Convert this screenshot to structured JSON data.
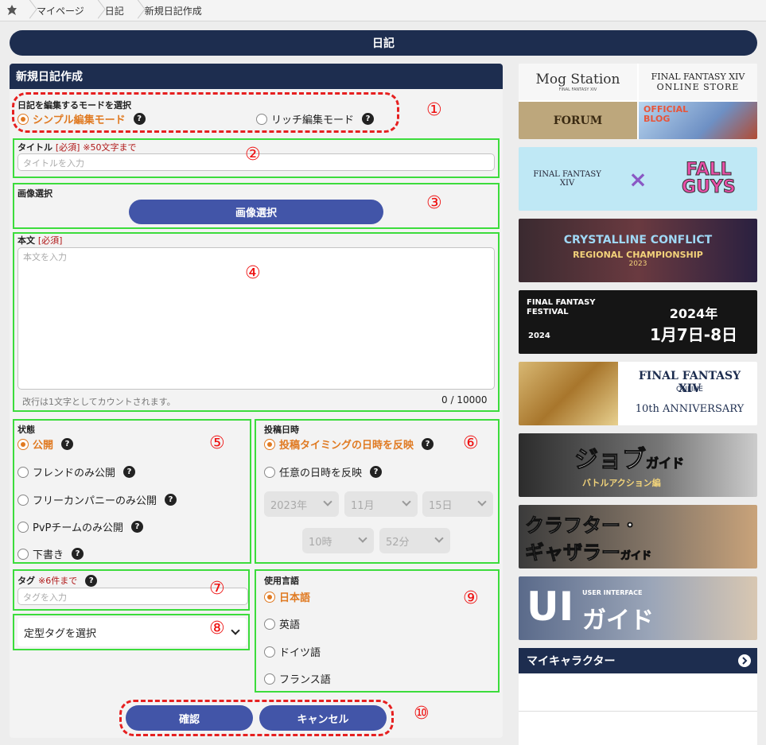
{
  "breadcrumb": {
    "items": [
      "マイページ",
      "日記",
      "新規日記作成"
    ]
  },
  "page_title": "日記",
  "form": {
    "heading": "新規日記作成",
    "mode": {
      "label": "日記を編集するモードを選択",
      "simple": "シンプル編集モード",
      "rich": "リッチ編集モード"
    },
    "title_field": {
      "label": "タイトル",
      "required": "[必須]",
      "note": "※50文字まで",
      "placeholder": "タイトルを入力"
    },
    "image": {
      "label": "画像選択",
      "button": "画像選択"
    },
    "body": {
      "label": "本文",
      "required": "[必須]",
      "placeholder": "本文を入力",
      "hint": "改行は1文字としてカウントされます。",
      "counter": "0 / 10000"
    },
    "status": {
      "label": "状態",
      "options": [
        "公開",
        "フレンドのみ公開",
        "フリーカンパニーのみ公開",
        "PvPチームのみ公開",
        "下書き"
      ]
    },
    "post_date": {
      "label": "投稿日時",
      "option_auto": "投稿タイミングの日時を反映",
      "option_custom": "任意の日時を反映",
      "year": "2023年",
      "month": "11月",
      "day": "15日",
      "hour": "10時",
      "minute": "52分"
    },
    "tags": {
      "label": "タグ",
      "note": "※6件まで",
      "placeholder": "タグを入力",
      "preset": "定型タグを選択"
    },
    "language": {
      "label": "使用言語",
      "options": [
        "日本語",
        "英語",
        "ドイツ語",
        "フランス語"
      ]
    },
    "confirm": "確認",
    "cancel": "キャンセル"
  },
  "annotations": [
    "①",
    "②",
    "③",
    "④",
    "⑤",
    "⑥",
    "⑦",
    "⑧",
    "⑨",
    "⑩"
  ],
  "sidebar": {
    "mog_station": "Mog Station",
    "mog_sub": "FINAL FANTASY XIV",
    "store_title": "FINAL FANTASY XIV",
    "store_sub": "ONLINE STORE",
    "forum": "FORUM",
    "blog": "OFFICIAL BLOG",
    "collab_left": "FINAL FANTASY XIV",
    "collab_x": "×",
    "collab_right": "FALL GUYS",
    "cc_title": "CRYSTALLINE CONFLICT",
    "cc_sub": "REGIONAL CHAMPIONSHIP",
    "cc_year": "2023",
    "fest_name": "FINAL FANTASY FESTIVAL",
    "fest_year": "2024",
    "fest_date_year": "2024年",
    "fest_date": "1月7日-8日",
    "anniv_title": "FINAL FANTASY XIV",
    "anniv_online": "ONLINE",
    "anniv_sub": "10th ANNIVERSARY",
    "job_guide": "ジョブ",
    "job_guide_small": "ガイド",
    "job_sub": "バトルアクション編",
    "crafter": "クラフター・",
    "gatherer": "ギャザラー",
    "gatherer_small": "ガイド",
    "ui_big": "UI",
    "ui_kana": "ガイド",
    "ui_sub": "USER INTERFACE",
    "my_character": "マイキャラクター"
  },
  "colors": {
    "navy": "#1d2d4f",
    "button": "#4255a8",
    "accent_orange": "#e07a22",
    "annotation_red": "#e62020",
    "annotation_green": "#3cdc3c"
  }
}
